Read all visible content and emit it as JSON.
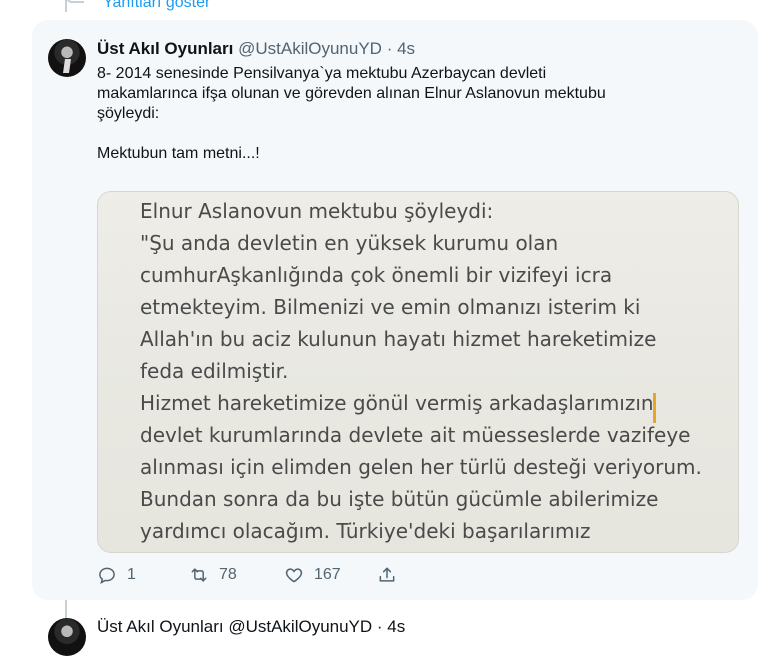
{
  "show_replies": "Yanıtları göster",
  "tweet": {
    "author_name": "Üst Akıl Oyunları",
    "author_handle": "@UstAkilOyunuYD",
    "separator": "·",
    "time": "4s",
    "text_line1": "8- 2014 senesinde Pensilvanya`ya mektubu Azerbaycan devleti",
    "text_line2": "makamlarınca ifşa olunan ve görevden alınan Elnur Aslanovun mektubu",
    "text_line3": "şöyleydi:",
    "text_line4": "Mektubun tam metni...!",
    "image_lines": [
      "Elnur Aslanovun mektubu şöyleydi:",
      "\"Şu anda devletin en yüksek kurumu olan",
      "cumhurAşkanlığında çok önemli bir vizifeyi icra",
      "etmekteyim. Bilmenizi ve emin olmanızı isterim ki",
      "Allah'ın bu aciz kulunun hayatı hizmet hareketimize",
      "feda edilmiştir.",
      "Hizmet hareketimize gönül vermiş arkadaşlarımızın",
      "devlet kurumlarında devlete ait müesseslerde vazifeye",
      "alınması için elimden gelen her türlü desteği veriyorum.",
      "Bundan sonra da bu işte bütün gücümle abilerimize",
      "yardımcı olacağım. Türkiye'deki başarılarımız"
    ],
    "replies": "1",
    "retweets": "78",
    "likes": "167"
  },
  "next_tweet": {
    "header": "Üst Akıl Oyunları @UstAkilOyunuYD · 4s"
  },
  "icons": {
    "reply": "reply-icon",
    "retweet": "retweet-icon",
    "like": "heart-icon",
    "share": "share-icon"
  },
  "colors": {
    "link": "#1d9bf0",
    "muted": "#536471",
    "card_bg": "#f5f8fa",
    "cursor": "#e7a62a"
  }
}
